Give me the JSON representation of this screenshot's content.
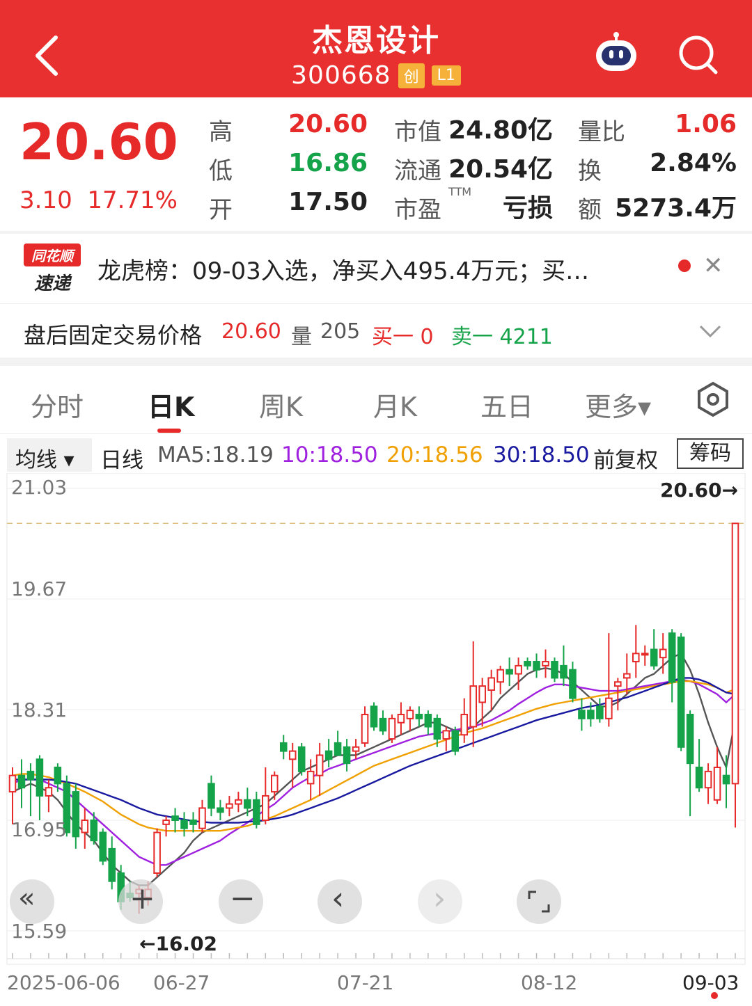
{
  "header": {
    "title": "杰恩设计",
    "code": "300668",
    "tag1": "创",
    "tag2": "L1"
  },
  "quote": {
    "price": "20.60",
    "change": "3.10",
    "change_pct": "17.71%",
    "high_label": "高",
    "high": "20.60",
    "low_label": "低",
    "low": "16.86",
    "open_label": "开",
    "open": "17.50",
    "mcap_label": "市值",
    "mcap": "24.80亿",
    "float_label": "流通",
    "float": "20.54亿",
    "pe_label": "市盈",
    "pe_sup": "TTM",
    "pe": "亏损",
    "vr_label": "量比",
    "vr": "1.06",
    "turn_label": "换",
    "turn": "2.84%",
    "amt_label": "额",
    "amt": "5273.4万"
  },
  "news": {
    "logo_top": "同花顺",
    "logo_bottom": "速递",
    "text": "龙虎榜：09-03入选，净买入495.4万元；买…"
  },
  "after_hours": {
    "label": "盘后固定交易价格",
    "price": "20.60",
    "vol_label": "量",
    "vol": "205",
    "buy": "买一 0",
    "sell": "卖一 4211"
  },
  "tabs": [
    "分时",
    "日K",
    "周K",
    "月K",
    "五日",
    "更多▾"
  ],
  "ma_bar": {
    "selector": "均线 ▾",
    "period": "日线",
    "ma5": "MA5:18.19",
    "ma10": "10:18.50",
    "ma20": "20:18.56",
    "ma30": "30:18.50",
    "adjust": "前复权",
    "chip": "筹码"
  },
  "colors": {
    "up": "#e62a2a",
    "down": "#15a34a",
    "ma5": "#555555",
    "ma10": "#a020e0",
    "ma20": "#f0a000",
    "ma30": "#1a1aa0",
    "header": "#e93030"
  },
  "chart_data": {
    "type": "candlestick",
    "y_ticks": [
      "21.03",
      "19.67",
      "18.31",
      "16.95",
      "15.59"
    ],
    "ylim": [
      15.59,
      21.03
    ],
    "x_ticks": [
      "2025-06-06",
      "06-27",
      "07-21",
      "08-12",
      "09-03"
    ],
    "last_price_label": "20.60→",
    "low_marker": "←16.02",
    "candles": [
      {
        "o": 17.3,
        "h": 17.6,
        "l": 16.9,
        "c": 17.5
      },
      {
        "o": 17.5,
        "h": 17.7,
        "l": 17.1,
        "c": 17.35
      },
      {
        "o": 17.55,
        "h": 17.65,
        "l": 17.0,
        "c": 17.45
      },
      {
        "o": 17.7,
        "h": 17.75,
        "l": 16.95,
        "c": 17.25
      },
      {
        "o": 17.25,
        "h": 17.45,
        "l": 17.05,
        "c": 17.35
      },
      {
        "o": 17.6,
        "h": 17.65,
        "l": 17.3,
        "c": 17.4
      },
      {
        "o": 17.4,
        "h": 17.5,
        "l": 16.75,
        "c": 16.8
      },
      {
        "o": 17.3,
        "h": 17.4,
        "l": 16.6,
        "c": 16.75
      },
      {
        "o": 16.8,
        "h": 17.1,
        "l": 16.6,
        "c": 16.95
      },
      {
        "o": 16.95,
        "h": 17.05,
        "l": 16.65,
        "c": 16.7
      },
      {
        "o": 16.8,
        "h": 16.85,
        "l": 16.4,
        "c": 16.45
      },
      {
        "o": 16.6,
        "h": 16.75,
        "l": 16.1,
        "c": 16.2
      },
      {
        "o": 16.3,
        "h": 16.4,
        "l": 15.85,
        "c": 15.95
      },
      {
        "o": 16.05,
        "h": 16.2,
        "l": 15.95,
        "c": 16.0
      },
      {
        "o": 16.05,
        "h": 16.15,
        "l": 15.8,
        "c": 16.1
      },
      {
        "o": 16.0,
        "h": 16.2,
        "l": 15.9,
        "c": 16.1
      },
      {
        "o": 16.3,
        "h": 16.85,
        "l": 16.25,
        "c": 16.8
      },
      {
        "o": 16.9,
        "h": 17.0,
        "l": 16.75,
        "c": 16.95
      },
      {
        "o": 17.0,
        "h": 17.1,
        "l": 16.8,
        "c": 16.95
      },
      {
        "o": 16.95,
        "h": 17.05,
        "l": 16.75,
        "c": 16.85
      },
      {
        "o": 16.95,
        "h": 17.05,
        "l": 16.8,
        "c": 16.9
      },
      {
        "o": 16.85,
        "h": 17.2,
        "l": 16.8,
        "c": 17.1
      },
      {
        "o": 17.4,
        "h": 17.5,
        "l": 17.0,
        "c": 17.1
      },
      {
        "o": 17.1,
        "h": 17.2,
        "l": 16.95,
        "c": 17.05
      },
      {
        "o": 17.1,
        "h": 17.25,
        "l": 17.0,
        "c": 17.15
      },
      {
        "o": 17.15,
        "h": 17.3,
        "l": 17.05,
        "c": 17.2
      },
      {
        "o": 17.2,
        "h": 17.35,
        "l": 17.0,
        "c": 17.1
      },
      {
        "o": 17.2,
        "h": 17.3,
        "l": 16.85,
        "c": 16.9
      },
      {
        "o": 16.95,
        "h": 17.6,
        "l": 16.9,
        "c": 17.25
      },
      {
        "o": 17.3,
        "h": 17.55,
        "l": 17.2,
        "c": 17.5
      },
      {
        "o": 17.9,
        "h": 18.0,
        "l": 17.7,
        "c": 17.8
      },
      {
        "o": 17.7,
        "h": 17.9,
        "l": 17.35,
        "c": 17.8
      },
      {
        "o": 17.85,
        "h": 17.9,
        "l": 17.5,
        "c": 17.55
      },
      {
        "o": 17.4,
        "h": 17.7,
        "l": 17.2,
        "c": 17.55
      },
      {
        "o": 17.5,
        "h": 17.9,
        "l": 17.25,
        "c": 17.75
      },
      {
        "o": 17.8,
        "h": 17.95,
        "l": 17.6,
        "c": 17.7
      },
      {
        "o": 17.9,
        "h": 18.05,
        "l": 17.75,
        "c": 17.75
      },
      {
        "o": 17.85,
        "h": 17.95,
        "l": 17.55,
        "c": 17.65
      },
      {
        "o": 17.8,
        "h": 17.95,
        "l": 17.7,
        "c": 17.85
      },
      {
        "o": 17.9,
        "h": 18.35,
        "l": 17.85,
        "c": 18.25
      },
      {
        "o": 18.35,
        "h": 18.4,
        "l": 18.05,
        "c": 18.1
      },
      {
        "o": 18.2,
        "h": 18.3,
        "l": 18.0,
        "c": 18.05
      },
      {
        "o": 17.95,
        "h": 18.25,
        "l": 17.9,
        "c": 18.2
      },
      {
        "o": 18.15,
        "h": 18.4,
        "l": 18.0,
        "c": 18.25
      },
      {
        "o": 18.2,
        "h": 18.35,
        "l": 18.05,
        "c": 18.3
      },
      {
        "o": 18.25,
        "h": 18.35,
        "l": 18.1,
        "c": 18.2
      },
      {
        "o": 18.25,
        "h": 18.3,
        "l": 18.0,
        "c": 18.1
      },
      {
        "o": 18.2,
        "h": 18.25,
        "l": 17.85,
        "c": 17.95
      },
      {
        "o": 17.95,
        "h": 18.1,
        "l": 17.8,
        "c": 18.05
      },
      {
        "o": 18.05,
        "h": 18.1,
        "l": 17.75,
        "c": 17.8
      },
      {
        "o": 18.0,
        "h": 18.45,
        "l": 17.9,
        "c": 18.25
      },
      {
        "o": 18.1,
        "h": 19.15,
        "l": 17.85,
        "c": 18.6
      },
      {
        "o": 18.4,
        "h": 18.7,
        "l": 18.1,
        "c": 18.6
      },
      {
        "o": 18.55,
        "h": 18.8,
        "l": 18.3,
        "c": 18.7
      },
      {
        "o": 18.65,
        "h": 18.85,
        "l": 18.5,
        "c": 18.8
      },
      {
        "o": 18.8,
        "h": 18.95,
        "l": 18.6,
        "c": 18.75
      },
      {
        "o": 18.75,
        "h": 18.95,
        "l": 18.55,
        "c": 18.85
      },
      {
        "o": 18.9,
        "h": 18.95,
        "l": 18.8,
        "c": 18.85
      },
      {
        "o": 18.9,
        "h": 19.0,
        "l": 18.7,
        "c": 18.8
      },
      {
        "o": 18.85,
        "h": 19.05,
        "l": 18.7,
        "c": 18.9
      },
      {
        "o": 18.9,
        "h": 18.95,
        "l": 18.65,
        "c": 18.7
      },
      {
        "o": 18.85,
        "h": 19.1,
        "l": 18.6,
        "c": 18.7
      },
      {
        "o": 18.8,
        "h": 18.9,
        "l": 18.4,
        "c": 18.45
      },
      {
        "o": 18.3,
        "h": 18.45,
        "l": 18.05,
        "c": 18.2
      },
      {
        "o": 18.3,
        "h": 18.4,
        "l": 18.1,
        "c": 18.2
      },
      {
        "o": 18.35,
        "h": 18.45,
        "l": 18.15,
        "c": 18.2
      },
      {
        "o": 18.2,
        "h": 19.25,
        "l": 18.1,
        "c": 18.45
      },
      {
        "o": 18.6,
        "h": 18.7,
        "l": 18.3,
        "c": 18.65
      },
      {
        "o": 18.7,
        "h": 19.0,
        "l": 18.5,
        "c": 18.75
      },
      {
        "o": 18.9,
        "h": 19.35,
        "l": 18.7,
        "c": 19.0
      },
      {
        "o": 19.0,
        "h": 19.1,
        "l": 18.85,
        "c": 19.0
      },
      {
        "o": 19.05,
        "h": 19.3,
        "l": 18.8,
        "c": 18.85
      },
      {
        "o": 18.95,
        "h": 19.25,
        "l": 18.75,
        "c": 19.05
      },
      {
        "o": 19.25,
        "h": 19.3,
        "l": 18.4,
        "c": 18.65
      },
      {
        "o": 19.2,
        "h": 19.25,
        "l": 17.8,
        "c": 17.85
      },
      {
        "o": 18.25,
        "h": 18.3,
        "l": 17.0,
        "c": 17.65
      },
      {
        "o": 17.6,
        "h": 17.95,
        "l": 17.3,
        "c": 17.35
      },
      {
        "o": 17.35,
        "h": 17.65,
        "l": 17.15,
        "c": 17.55
      },
      {
        "o": 17.2,
        "h": 17.85,
        "l": 17.15,
        "c": 17.6
      },
      {
        "o": 17.5,
        "h": 17.75,
        "l": 17.1,
        "c": 17.4
      },
      {
        "o": 17.4,
        "h": 20.6,
        "l": 16.86,
        "c": 20.6
      }
    ],
    "ma_series": [
      {
        "name": "MA5",
        "color": "#555555",
        "values": [
          17.3,
          17.35,
          17.4,
          17.35,
          17.3,
          17.2,
          17.05,
          16.9,
          16.8,
          16.7,
          16.55,
          16.4,
          16.3,
          16.2,
          16.15,
          16.15,
          16.25,
          16.35,
          16.45,
          16.55,
          16.7,
          16.8,
          16.85,
          16.9,
          16.95,
          17.0,
          17.05,
          17.1,
          17.15,
          17.25,
          17.35,
          17.45,
          17.55,
          17.6,
          17.65,
          17.7,
          17.75,
          17.75,
          17.75,
          17.8,
          17.85,
          17.9,
          17.95,
          18.0,
          18.05,
          18.1,
          18.15,
          18.15,
          18.1,
          18.05,
          18.05,
          18.1,
          18.2,
          18.3,
          18.45,
          18.55,
          18.65,
          18.75,
          18.8,
          18.82,
          18.8,
          18.75,
          18.65,
          18.55,
          18.45,
          18.35,
          18.35,
          18.4,
          18.5,
          18.6,
          18.7,
          18.75,
          18.85,
          18.95,
          19.0,
          18.8,
          18.5,
          18.15,
          17.85,
          17.6,
          18.19
        ]
      },
      {
        "name": "MA10",
        "color": "#a020e0",
        "values": [
          17.4,
          17.45,
          17.45,
          17.45,
          17.4,
          17.35,
          17.3,
          17.2,
          17.1,
          17.0,
          16.9,
          16.8,
          16.7,
          16.6,
          16.5,
          16.45,
          16.4,
          16.4,
          16.45,
          16.5,
          16.55,
          16.6,
          16.65,
          16.7,
          16.78,
          16.85,
          16.92,
          17.0,
          17.08,
          17.15,
          17.25,
          17.35,
          17.42,
          17.48,
          17.52,
          17.58,
          17.62,
          17.66,
          17.7,
          17.74,
          17.78,
          17.82,
          17.86,
          17.9,
          17.94,
          17.98,
          18.0,
          18.02,
          18.04,
          18.06,
          18.08,
          18.1,
          18.14,
          18.18,
          18.24,
          18.3,
          18.38,
          18.45,
          18.52,
          18.58,
          18.62,
          18.62,
          18.6,
          18.58,
          18.56,
          18.54,
          18.54,
          18.54,
          18.56,
          18.58,
          18.6,
          18.62,
          18.64,
          18.66,
          18.68,
          18.66,
          18.62,
          18.56,
          18.5,
          18.4,
          18.5
        ]
      },
      {
        "name": "MA20",
        "color": "#f0a000",
        "values": [
          17.5,
          17.52,
          17.52,
          17.5,
          17.48,
          17.44,
          17.4,
          17.35,
          17.3,
          17.24,
          17.18,
          17.1,
          17.02,
          16.96,
          16.9,
          16.86,
          16.84,
          16.82,
          16.82,
          16.82,
          16.82,
          16.82,
          16.82,
          16.82,
          16.84,
          16.86,
          16.88,
          16.92,
          16.96,
          17.0,
          17.05,
          17.1,
          17.15,
          17.2,
          17.26,
          17.32,
          17.38,
          17.44,
          17.5,
          17.56,
          17.62,
          17.66,
          17.7,
          17.74,
          17.78,
          17.82,
          17.86,
          17.9,
          17.94,
          17.98,
          18.02,
          18.05,
          18.08,
          18.12,
          18.16,
          18.2,
          18.24,
          18.28,
          18.32,
          18.35,
          18.38,
          18.4,
          18.42,
          18.44,
          18.46,
          18.48,
          18.5,
          18.52,
          18.54,
          18.56,
          18.58,
          18.6,
          18.62,
          18.64,
          18.66,
          18.66,
          18.64,
          18.62,
          18.58,
          18.52,
          18.56
        ]
      },
      {
        "name": "MA30",
        "color": "#1a1aa0",
        "values": [
          17.45,
          17.45,
          17.45,
          17.45,
          17.45,
          17.44,
          17.42,
          17.4,
          17.36,
          17.32,
          17.28,
          17.24,
          17.2,
          17.15,
          17.1,
          17.06,
          17.02,
          17.0,
          16.98,
          16.96,
          16.94,
          16.93,
          16.92,
          16.92,
          16.92,
          16.92,
          16.93,
          16.94,
          16.95,
          16.97,
          16.99,
          17.02,
          17.06,
          17.1,
          17.14,
          17.18,
          17.22,
          17.27,
          17.32,
          17.37,
          17.42,
          17.47,
          17.52,
          17.57,
          17.62,
          17.66,
          17.7,
          17.74,
          17.78,
          17.82,
          17.86,
          17.9,
          17.94,
          17.98,
          18.02,
          18.06,
          18.1,
          18.14,
          18.18,
          18.21,
          18.24,
          18.27,
          18.3,
          18.33,
          18.35,
          18.37,
          18.4,
          18.43,
          18.46,
          18.5,
          18.54,
          18.58,
          18.62,
          18.66,
          18.7,
          18.7,
          18.68,
          18.64,
          18.58,
          18.52,
          18.5
        ]
      }
    ]
  },
  "controls": [
    "«",
    "+",
    "−",
    "‹",
    "›",
    "⛶"
  ]
}
